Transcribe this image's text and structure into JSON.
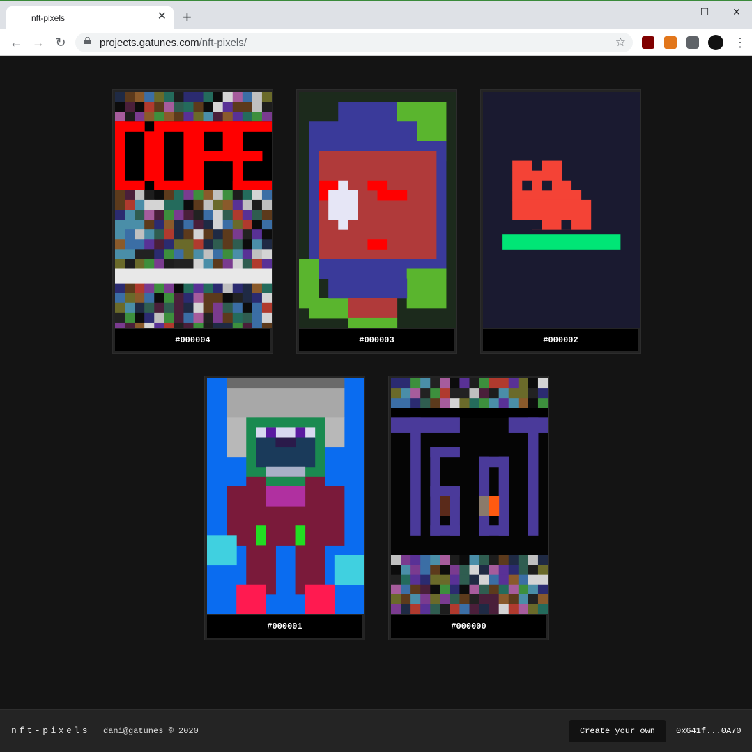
{
  "browser": {
    "tab_title": "nft-pixels",
    "url_host": "projects.gatunes.com",
    "url_path": "/nft-pixels/"
  },
  "cards": [
    {
      "label": "#000004",
      "art": "dope"
    },
    {
      "label": "#000003",
      "art": "mask"
    },
    {
      "label": "#000002",
      "art": "invader"
    },
    {
      "label": "#000001",
      "art": "robot"
    },
    {
      "label": "#000000",
      "art": "text"
    }
  ],
  "footer": {
    "brand": "nft-pixels",
    "copyright": "dani@gatunes © 2020",
    "create_label": "Create your own",
    "address": "0x641f...0A70"
  },
  "colors": {
    "page_bg": "#141414",
    "footer_bg": "#242424",
    "invader_red": "#f44336",
    "invader_ground": "#00e676"
  }
}
